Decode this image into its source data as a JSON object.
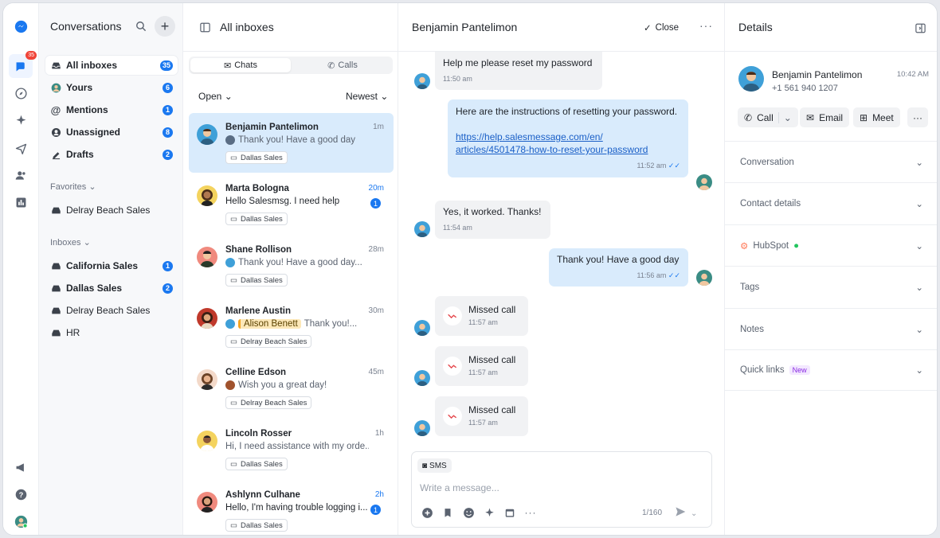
{
  "rail": {
    "badge": "35"
  },
  "sidebar": {
    "title": "Conversations",
    "nav": [
      {
        "label": "All inboxes",
        "count": "35",
        "icon": "inbox-icon"
      },
      {
        "label": "Yours",
        "count": "6",
        "icon": "avatar-icon"
      },
      {
        "label": "Mentions",
        "count": "1",
        "icon": "at-icon"
      },
      {
        "label": "Unassigned",
        "count": "8",
        "icon": "user-icon"
      },
      {
        "label": "Drafts",
        "count": "2",
        "icon": "pencil-icon"
      }
    ],
    "favorites_label": "Favorites",
    "favorites": [
      {
        "label": "Delray Beach Sales"
      }
    ],
    "inboxes_label": "Inboxes",
    "inboxes": [
      {
        "label": "California Sales",
        "count": "1"
      },
      {
        "label": "Dallas Sales",
        "count": "2"
      },
      {
        "label": "Delray Beach Sales",
        "count": ""
      },
      {
        "label": "HR",
        "count": ""
      }
    ]
  },
  "list": {
    "title": "All inboxes",
    "tab_chats": "Chats",
    "tab_calls": "Calls",
    "filter_status": "Open",
    "filter_sort": "Newest",
    "items": [
      {
        "name": "Benjamin Pantelimon",
        "time": "1m",
        "preview": "Thank you! Have a good day",
        "tag": "Dallas Sales",
        "unread": ""
      },
      {
        "name": "Marta Bologna",
        "time": "20m",
        "preview": "Hello Salesmsg. I need help",
        "tag": "Dallas Sales",
        "unread": "1"
      },
      {
        "name": "Shane Rollison",
        "time": "28m",
        "preview": "Thank you! Have a good day...",
        "tag": "Dallas Sales",
        "unread": ""
      },
      {
        "name": "Marlene Austin",
        "time": "30m",
        "mention": "Alison Benett",
        "preview": "Thank you!...",
        "tag": "Delray Beach Sales",
        "unread": ""
      },
      {
        "name": "Celline Edson",
        "time": "45m",
        "preview": "Wish you a great day!",
        "tag": "Delray Beach Sales",
        "unread": ""
      },
      {
        "name": "Lincoln Rosser",
        "time": "1h",
        "preview": "Hi, I need assistance with my orde...",
        "tag": "Dallas Sales",
        "unread": ""
      },
      {
        "name": "Ashlynn Culhane",
        "time": "2h",
        "preview": "Hello, I'm having trouble logging i...",
        "tag": "Dallas Sales",
        "unread": "1"
      }
    ]
  },
  "chat": {
    "title": "Benjamin Pantelimon",
    "close_label": "Close",
    "messages": [
      {
        "text": "Help me please reset my password",
        "time": "11:50 am"
      },
      {
        "text": "Here are the instructions of resetting your password.",
        "link": "https://help.salesmessage.com/en/articles/4501478-how-to-reset-your-password",
        "link_line1": "https://help.salesmessage.com/en/",
        "link_line2": "articles/4501478-how-to-reset-your-password",
        "time": "11:52 am"
      },
      {
        "text": "Yes, it worked. Thanks!",
        "time": "11:54 am"
      },
      {
        "text": "Thank you! Have a good day",
        "time": "11:56 am"
      }
    ],
    "missed": [
      {
        "label": "Missed call",
        "time": "11:57 am"
      },
      {
        "label": "Missed call",
        "time": "11:57 am"
      },
      {
        "label": "Missed call",
        "time": "11:57 am"
      }
    ],
    "composer": {
      "channel": "SMS",
      "placeholder": "Write a message...",
      "count": "1/160"
    }
  },
  "details": {
    "title": "Details",
    "name": "Benjamin Pantelimon",
    "phone": "+1 561 940 1207",
    "time": "10:42 AM",
    "call_label": "Call",
    "email_label": "Email",
    "meet_label": "Meet",
    "sections": [
      "Conversation",
      "Contact details",
      "HubSpot",
      "Tags",
      "Notes",
      "Quick links"
    ],
    "new_badge": "New"
  },
  "colors": {
    "accent": "#1a78f0",
    "selected_bg": "#d9ebfc",
    "missed": "#e5484d"
  }
}
